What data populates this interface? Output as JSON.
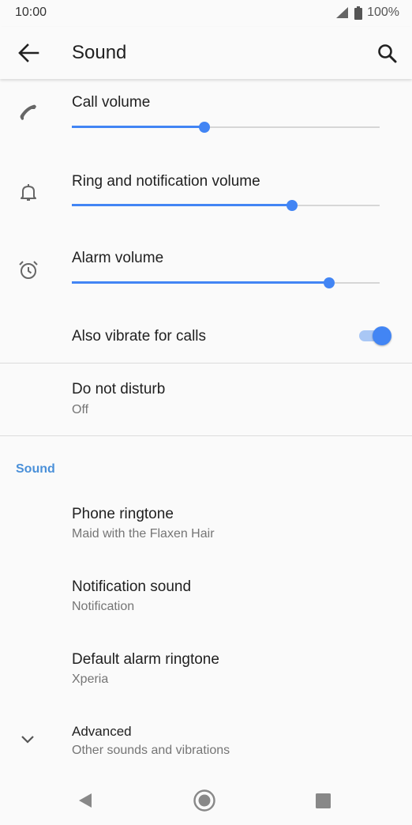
{
  "status": {
    "time": "10:00",
    "battery": "100%"
  },
  "appbar": {
    "title": "Sound"
  },
  "volumes": [
    {
      "label": "Call volume",
      "level": 0.43,
      "icon": "phone-icon"
    },
    {
      "label": "Ring and notification volume",
      "level": 0.715,
      "icon": "bell-icon"
    },
    {
      "label": "Alarm volume",
      "level": 0.835,
      "icon": "alarm-clock-icon"
    }
  ],
  "vibrate": {
    "label": "Also vibrate for calls",
    "on": true
  },
  "dnd": {
    "label": "Do not disturb",
    "value": "Off"
  },
  "section": {
    "title": "Sound"
  },
  "sound_items": [
    {
      "label": "Phone ringtone",
      "value": "Maid with the Flaxen Hair"
    },
    {
      "label": "Notification sound",
      "value": "Notification"
    },
    {
      "label": "Default alarm ringtone",
      "value": "Xperia"
    }
  ],
  "advanced": {
    "label": "Advanced",
    "value": "Other sounds and vibrations"
  },
  "colors": {
    "accent": "#4285f4",
    "section_header": "#4a90d9"
  }
}
